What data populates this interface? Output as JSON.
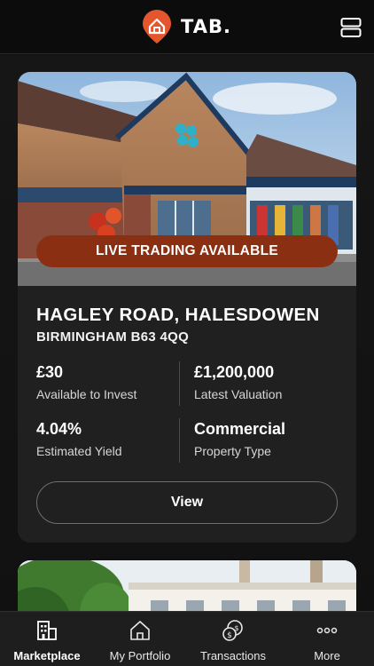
{
  "header": {
    "brand": "TAB.",
    "accent_color": "#e4572e"
  },
  "listing": {
    "badge": "LIVE TRADING AVAILABLE",
    "title": "HAGLEY ROAD, HALESDOWEN",
    "subtitle": "BIRMINGHAM B63 4QQ",
    "stats": [
      {
        "value": "£30",
        "label": "Available to Invest"
      },
      {
        "value": "£1,200,000",
        "label": "Latest Valuation"
      },
      {
        "value": "4.04%",
        "label": "Estimated Yield"
      },
      {
        "value": "Commercial",
        "label": "Property Type"
      }
    ],
    "view_label": "View"
  },
  "tabbar": {
    "items": [
      {
        "label": "Marketplace",
        "icon": "building-icon",
        "active": true
      },
      {
        "label": "My Portfolio",
        "icon": "home-icon",
        "active": false
      },
      {
        "label": "Transactions",
        "icon": "coins-icon",
        "active": false
      },
      {
        "label": "More",
        "icon": "dots-icon",
        "active": false
      }
    ]
  }
}
